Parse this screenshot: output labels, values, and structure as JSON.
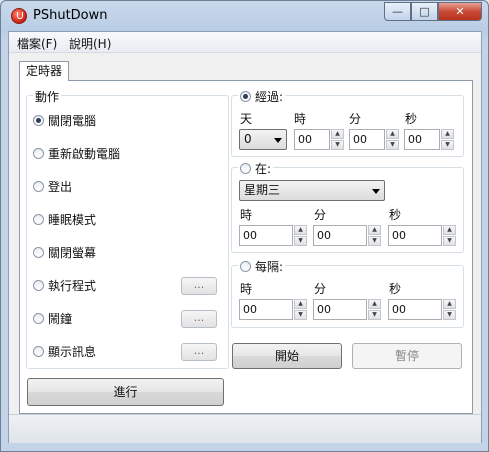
{
  "window": {
    "title": "PShutDown",
    "minimize": "—",
    "maximize": "□",
    "close": "✕"
  },
  "menu": [
    {
      "label": "檔案(F)"
    },
    {
      "label": "說明(H)"
    }
  ],
  "tab": {
    "label": "定時器"
  },
  "action": {
    "title": "動作",
    "options": [
      {
        "label": "關閉電腦",
        "selected": true
      },
      {
        "label": "重新啟動電腦",
        "selected": false
      },
      {
        "label": "登出",
        "selected": false
      },
      {
        "label": "睡眠模式",
        "selected": false
      },
      {
        "label": "關閉螢幕",
        "selected": false
      },
      {
        "label": "執行程式",
        "selected": false
      },
      {
        "label": "鬧鐘",
        "selected": false
      },
      {
        "label": "顯示訊息",
        "selected": false
      }
    ],
    "ellipsis": "...",
    "run_button": "進行"
  },
  "elapsed": {
    "label": "經過:",
    "selected": true,
    "headers": {
      "day": "天",
      "hour": "時",
      "minute": "分",
      "second": "秒"
    },
    "day_value": "0",
    "hour_value": "00",
    "minute_value": "00",
    "second_value": "00"
  },
  "at": {
    "label": "在:",
    "selected": false,
    "weekday": "星期三",
    "headers": {
      "hour": "時",
      "minute": "分",
      "second": "秒"
    },
    "hour_value": "00",
    "minute_value": "00",
    "second_value": "00"
  },
  "every": {
    "label": "每隔:",
    "selected": false,
    "headers": {
      "hour": "時",
      "minute": "分",
      "second": "秒"
    },
    "hour_value": "00",
    "minute_value": "00",
    "second_value": "00"
  },
  "buttons": {
    "start": "開始",
    "pause": "暫停"
  },
  "spin": {
    "up": "▲",
    "down": "▼"
  }
}
